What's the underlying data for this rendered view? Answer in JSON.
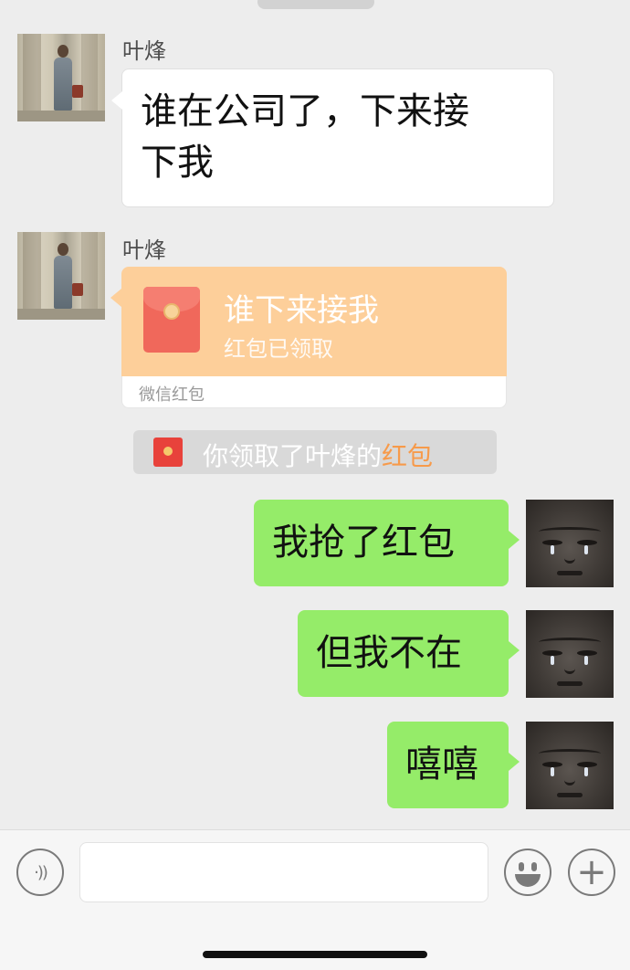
{
  "chat": {
    "messages": [
      {
        "sender": "叶烽",
        "text": "谁在公司了，下来接\n下我"
      },
      {
        "sender": "叶烽"
      },
      {
        "text": "我抢了红包"
      },
      {
        "text": "但我不在"
      },
      {
        "text": "嘻嘻"
      }
    ],
    "red_packet": {
      "title": "谁下来接我",
      "status": "红包已领取",
      "label": "微信红包"
    },
    "system_notice": {
      "text": "你领取了叶烽的",
      "link": "红包"
    }
  },
  "colors": {
    "sent_bubble": "#95ec69",
    "received_bubble": "#ffffff",
    "red_packet_bg": "#fdcf9a",
    "link": "#f79a4a"
  },
  "input_bar": {
    "voice_icon": "voice-icon",
    "emoji_icon": "emoji-icon",
    "plus_icon": "plus-icon",
    "placeholder": ""
  }
}
